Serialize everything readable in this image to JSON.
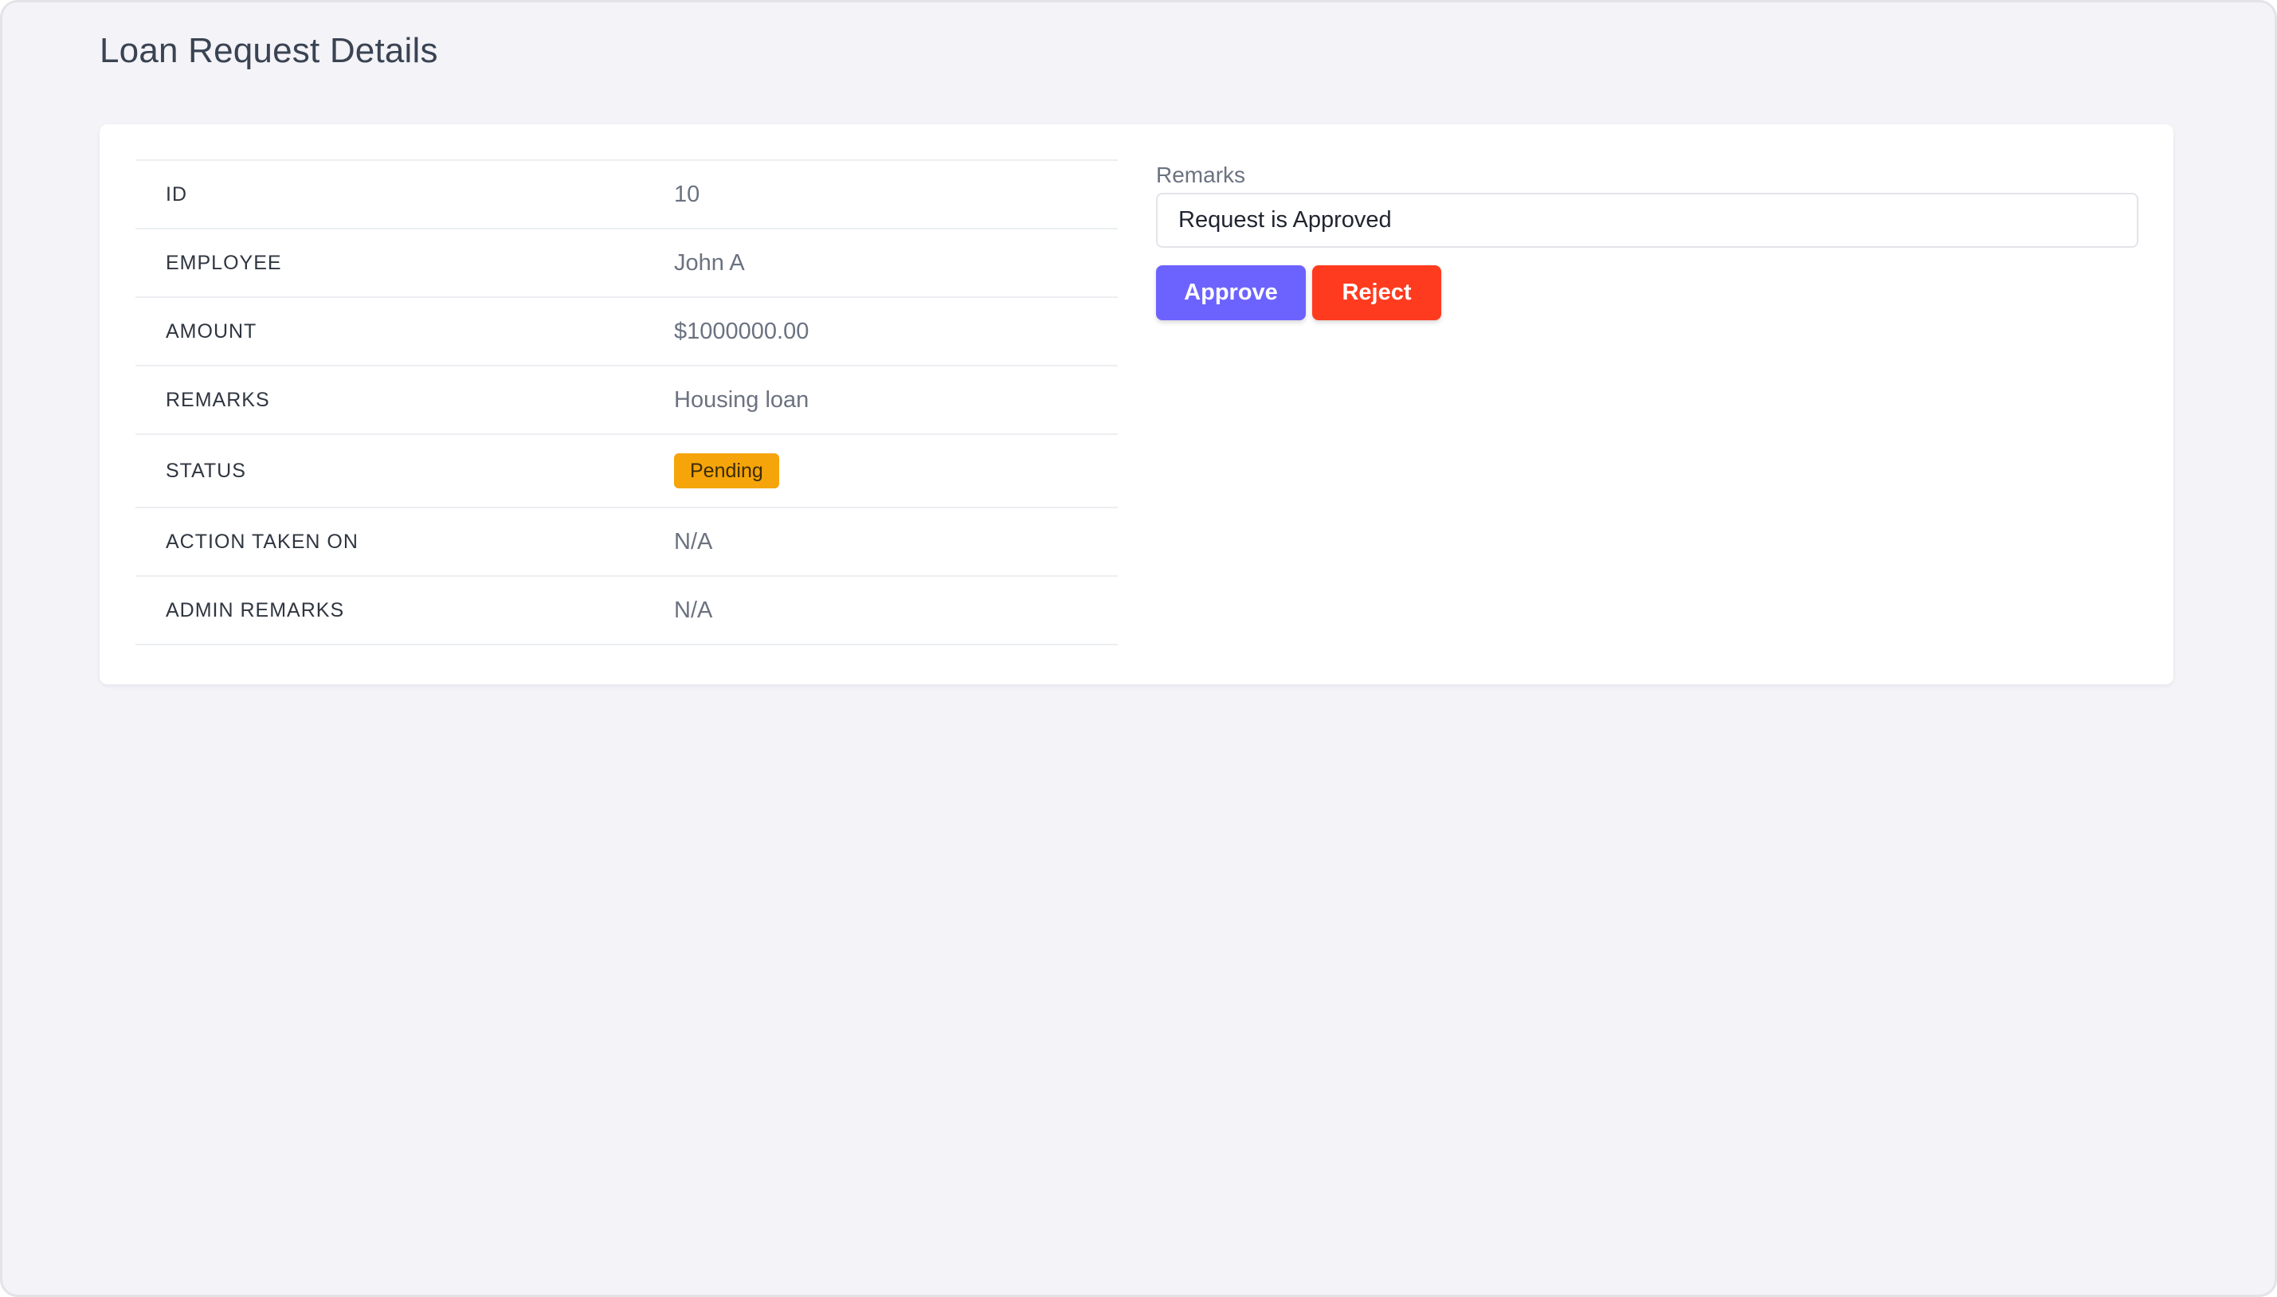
{
  "page": {
    "title": "Loan Request Details"
  },
  "details": {
    "rows": [
      {
        "label": "ID",
        "value": "10"
      },
      {
        "label": "EMPLOYEE",
        "value": "John A"
      },
      {
        "label": "AMOUNT",
        "value": "$1000000.00"
      },
      {
        "label": "REMARKS",
        "value": "Housing loan"
      },
      {
        "label": "STATUS",
        "value": "Pending"
      },
      {
        "label": "ACTION TAKEN ON",
        "value": "N/A"
      },
      {
        "label": "ADMIN REMARKS",
        "value": "N/A"
      }
    ]
  },
  "remarks_form": {
    "label": "Remarks",
    "value": "Request is Approved",
    "approve_label": "Approve",
    "reject_label": "Reject"
  },
  "colors": {
    "approve": "#6c63ff",
    "reject": "#ff3b1f",
    "status_pending": "#f5a40a",
    "background": "#f3f3f8"
  }
}
